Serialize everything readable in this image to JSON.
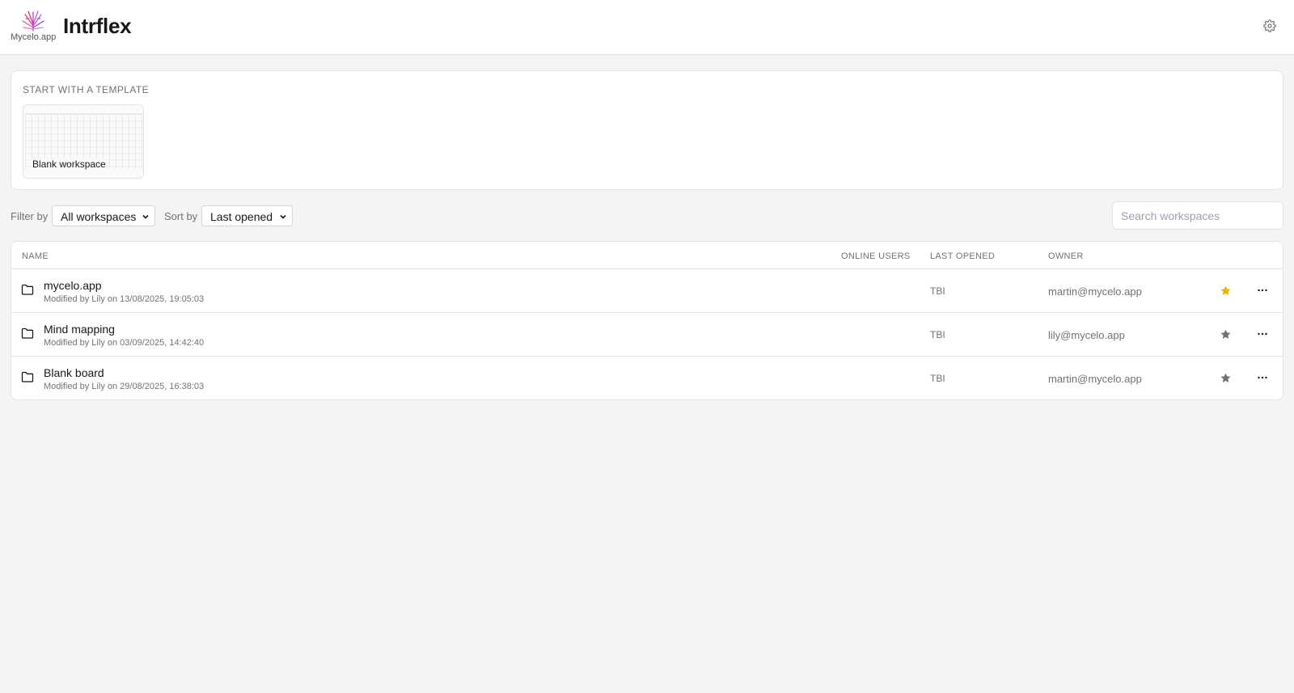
{
  "app": {
    "brand": "Mycelo.app",
    "title": "Intrflex"
  },
  "templates": {
    "heading": "START WITH A TEMPLATE",
    "items": [
      {
        "label": "Blank workspace"
      }
    ]
  },
  "filters": {
    "filter_label": "Filter by",
    "filter_value": "All workspaces",
    "sort_label": "Sort by",
    "sort_value": "Last opened",
    "search_placeholder": "Search workspaces"
  },
  "table": {
    "columns": {
      "name": "NAME",
      "online_users": "ONLINE USERS",
      "last_opened": "LAST OPENED",
      "owner": "OWNER"
    },
    "rows": [
      {
        "name": "mycelo.app",
        "meta": "Modified by Lily on 13/08/2025, 19:05:03",
        "last_opened": "TBI",
        "owner": "martin@mycelo.app",
        "starred": true
      },
      {
        "name": "Mind mapping",
        "meta": "Modified by Lily on 03/09/2025, 14:42:40",
        "last_opened": "TBI",
        "owner": "lily@mycelo.app",
        "starred": false
      },
      {
        "name": "Blank board",
        "meta": "Modified by Lily on 29/08/2025, 16:38:03",
        "last_opened": "TBI",
        "owner": "martin@mycelo.app",
        "starred": false
      }
    ]
  },
  "icons": {
    "logo": "mycelium-logo-icon",
    "settings": "gear-icon",
    "folder": "folder-icon",
    "star": "star-icon",
    "more": "more-horizontal-icon",
    "chevron": "chevron-down-icon"
  },
  "colors": {
    "star_active": "#eab308",
    "star_inactive": "#71717a",
    "logo_pink": "#db2777",
    "logo_purple": "#a855f7"
  }
}
